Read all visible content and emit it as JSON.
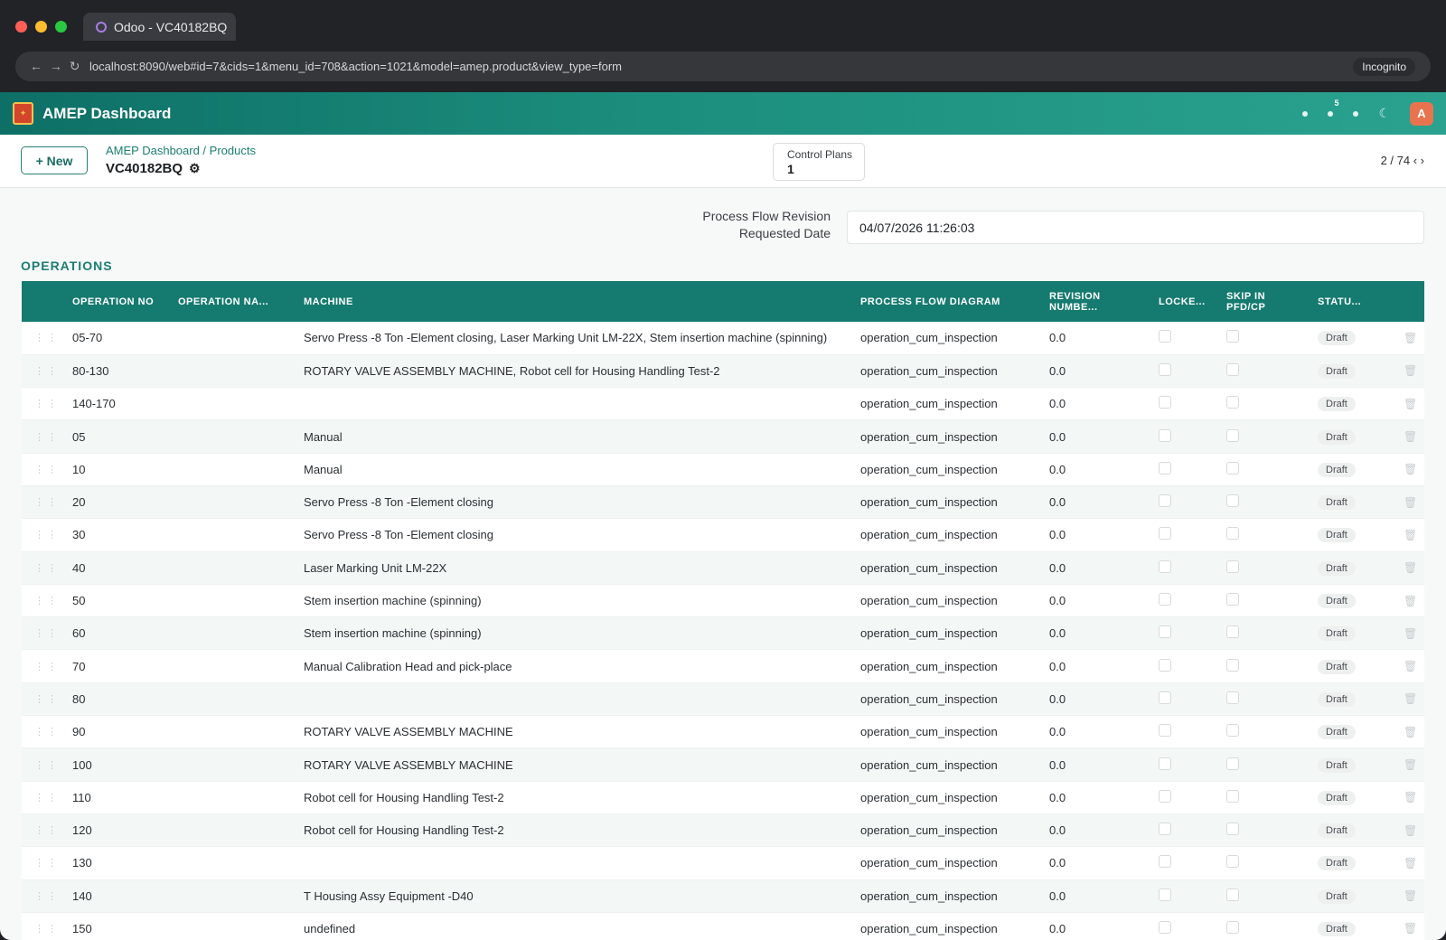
{
  "browser": {
    "tab_title": "Odoo - VC40182BQ",
    "url": "localhost:8090/web#id=7&cids=1&menu_id=708&action=1021&model=amep.product&view_type=form",
    "incognito_label": "Incognito",
    "nav_glyphs": "← → ↻",
    "traffic_colors": [
      "#ff5f57",
      "#febc2e",
      "#28c840"
    ]
  },
  "app": {
    "brand": "AMEP Dashboard",
    "notification_count": "5",
    "avatar_letter": "A",
    "accent_color": "#157a6f"
  },
  "control": {
    "new_label": "+ New",
    "breadcrumb": "AMEP Dashboard / Products",
    "record_name": "VC40182BQ",
    "smart_button": {
      "label": "Control Plans",
      "value": "1"
    },
    "pager": "2 / 74 ‹ ›"
  },
  "form": {
    "field_label_line1": "Process Flow Revision",
    "field_label_line2": "Requested Date",
    "field_value": "04/07/2026 11:26:03",
    "section_title": "OPERATIONS"
  },
  "table": {
    "headers": {
      "op_no": "OPERATION NO",
      "op_name": "OPERATION NA...",
      "machine": "MACHINE",
      "pfd": "PROCESS FLOW DIAGRAM",
      "rev_line1": "REVISION",
      "rev_line2": "NUMBE...",
      "locked": "LOCKE...",
      "skip_line1": "SKIP IN",
      "skip_line2": "PFD/CP",
      "status": "STATU..."
    },
    "rows": [
      {
        "op_no": "05-70",
        "op_name": "",
        "machine": "Servo Press -8 Ton -Element closing, Laser Marking Unit LM-22X, Stem insertion machine (spinning)",
        "pfd": "operation_cum_inspection",
        "rev": "0.0",
        "status": "Draft"
      },
      {
        "op_no": "80-130",
        "op_name": "",
        "machine": "ROTARY VALVE ASSEMBLY MACHINE, Robot cell for Housing Handling Test-2",
        "pfd": "operation_cum_inspection",
        "rev": "0.0",
        "status": "Draft"
      },
      {
        "op_no": "140-170",
        "op_name": "",
        "machine": "",
        "pfd": "operation_cum_inspection",
        "rev": "0.0",
        "status": "Draft"
      },
      {
        "op_no": "05",
        "op_name": "",
        "machine": "Manual",
        "pfd": "operation_cum_inspection",
        "rev": "0.0",
        "status": "Draft"
      },
      {
        "op_no": "10",
        "op_name": "",
        "machine": "Manual",
        "pfd": "operation_cum_inspection",
        "rev": "0.0",
        "status": "Draft"
      },
      {
        "op_no": "20",
        "op_name": "",
        "machine": "Servo Press -8 Ton -Element closing",
        "pfd": "operation_cum_inspection",
        "rev": "0.0",
        "status": "Draft"
      },
      {
        "op_no": "30",
        "op_name": "",
        "machine": "Servo Press -8 Ton -Element closing",
        "pfd": "operation_cum_inspection",
        "rev": "0.0",
        "status": "Draft"
      },
      {
        "op_no": "40",
        "op_name": "",
        "machine": "Laser Marking Unit LM-22X",
        "pfd": "operation_cum_inspection",
        "rev": "0.0",
        "status": "Draft"
      },
      {
        "op_no": "50",
        "op_name": "",
        "machine": "Stem insertion machine (spinning)",
        "pfd": "operation_cum_inspection",
        "rev": "0.0",
        "status": "Draft"
      },
      {
        "op_no": "60",
        "op_name": "",
        "machine": "Stem insertion machine (spinning)",
        "pfd": "operation_cum_inspection",
        "rev": "0.0",
        "status": "Draft"
      },
      {
        "op_no": "70",
        "op_name": "",
        "machine": "Manual Calibration Head and pick-place",
        "pfd": "operation_cum_inspection",
        "rev": "0.0",
        "status": "Draft"
      },
      {
        "op_no": "80",
        "op_name": "",
        "machine": "",
        "pfd": "operation_cum_inspection",
        "rev": "0.0",
        "status": "Draft"
      },
      {
        "op_no": "90",
        "op_name": "",
        "machine": "ROTARY VALVE ASSEMBLY MACHINE",
        "pfd": "operation_cum_inspection",
        "rev": "0.0",
        "status": "Draft"
      },
      {
        "op_no": "100",
        "op_name": "",
        "machine": "ROTARY VALVE ASSEMBLY MACHINE",
        "pfd": "operation_cum_inspection",
        "rev": "0.0",
        "status": "Draft"
      },
      {
        "op_no": "110",
        "op_name": "",
        "machine": "Robot cell for Housing Handling Test-2",
        "pfd": "operation_cum_inspection",
        "rev": "0.0",
        "status": "Draft"
      },
      {
        "op_no": "120",
        "op_name": "",
        "machine": "Robot cell for Housing Handling Test-2",
        "pfd": "operation_cum_inspection",
        "rev": "0.0",
        "status": "Draft"
      },
      {
        "op_no": "130",
        "op_name": "",
        "machine": "",
        "pfd": "operation_cum_inspection",
        "rev": "0.0",
        "status": "Draft"
      },
      {
        "op_no": "140",
        "op_name": "",
        "machine": "T Housing Assy Equipment -D40",
        "pfd": "operation_cum_inspection",
        "rev": "0.0",
        "status": "Draft"
      },
      {
        "op_no": "150",
        "op_name": "",
        "machine": "undefined",
        "pfd": "operation_cum_inspection",
        "rev": "0.0",
        "status": "Draft"
      }
    ]
  }
}
